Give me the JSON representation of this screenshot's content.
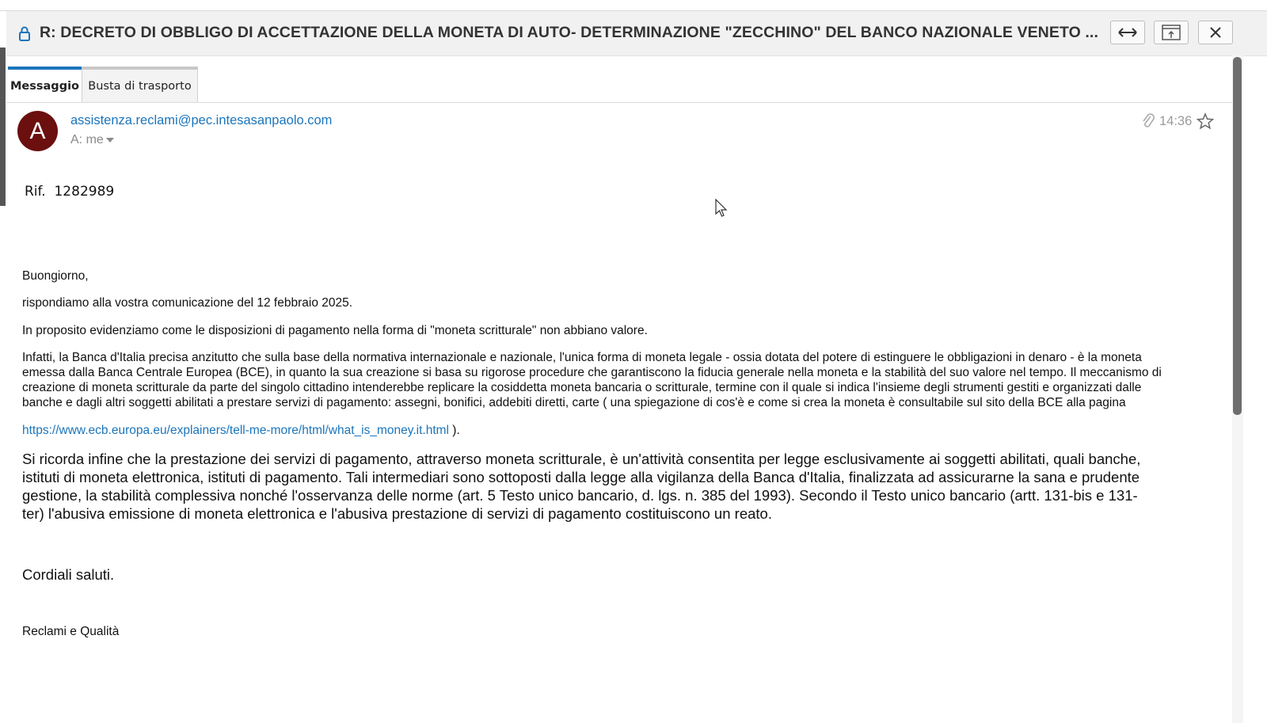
{
  "window": {
    "title": "R: DECRETO DI OBBLIGO DI ACCETTAZIONE DELLA MONETA DI AUTO- DETERMINAZIONE \"ZECCHINO\" DEL BANCO NAZIONALE VENETO ...",
    "buttons": [
      "expand-icon",
      "popout-icon",
      "close-icon"
    ]
  },
  "tabs": [
    {
      "label": "Messaggio",
      "active": true
    },
    {
      "label": "Busta di trasporto",
      "active": false
    }
  ],
  "header": {
    "avatar_letter": "A",
    "avatar_color": "#6b0f0f",
    "sender": "assistenza.reclami@pec.intesasanpaolo.com",
    "recipient": "A: me",
    "time": "14:36",
    "icons": [
      "attachment-icon",
      "star-icon"
    ]
  },
  "message": {
    "rif": "Rif.  1282989",
    "greeting": "Buongiorno,",
    "p1": "rispondiamo alla vostra comunicazione del 12 febbraio 2025.",
    "p2": "In proposito evidenziamo come le disposizioni di pagamento nella forma di \"moneta scritturale\" non abbiano valore.",
    "p3_lines": [
      "Infatti, la Banca d'Italia precisa anzitutto che sulla base della normativa internazionale e nazionale, l'unica forma di moneta legale - ossia dotata del potere di estinguere le obbligazioni in denaro - è la moneta",
      "emessa dalla Banca Centrale Europea (BCE), in quanto la sua creazione si basa su rigorose procedure che garantiscono la fiducia generale nella moneta e la stabilità del suo valore nel tempo. Il meccanismo di",
      "creazione di moneta scritturale da parte del singolo cittadino intenderebbe replicare la cosiddetta moneta bancaria o scritturale, termine con il quale si indica l'insieme degli strumenti gestiti e organizzati dalle",
      "banche e dagli altri soggetti abilitati a prestare servizi di pagamento: assegni, bonifici, addebiti diretti, carte ( una spiegazione di cos'è e come si crea la moneta è consultabile sul sito della BCE alla pagina"
    ],
    "link": "https://www.ecb.europa.eu/explainers/tell-me-more/html/what_is_money.it.html",
    "link_suffix": " ).",
    "p4_lines": [
      "Si ricorda infine che la prestazione dei servizi di pagamento, attraverso moneta scritturale, è un'attività consentita per legge esclusivamente ai soggetti abilitati, quali banche,",
      "istituti di moneta elettronica, istituti di pagamento. Tali intermediari sono sottoposti dalla legge alla vigilanza della Banca d'Italia, finalizzata ad assicurarne la sana e prudente",
      "gestione, la stabilità complessiva nonché l'osservanza delle norme (art. 5 Testo unico bancario, d. lgs. n. 385 del 1993). Secondo il Testo unico bancario (artt. 131-bis e 131-",
      "ter) l'abusiva emissione di moneta elettronica e l'abusiva prestazione di servizi di pagamento costituiscono un reato."
    ],
    "closing": "Cordiali saluti.",
    "signature": "Reclami e Qualità"
  },
  "colors": {
    "accent": "#1b75bb",
    "titlebar_bg": "#f1f1f1"
  }
}
